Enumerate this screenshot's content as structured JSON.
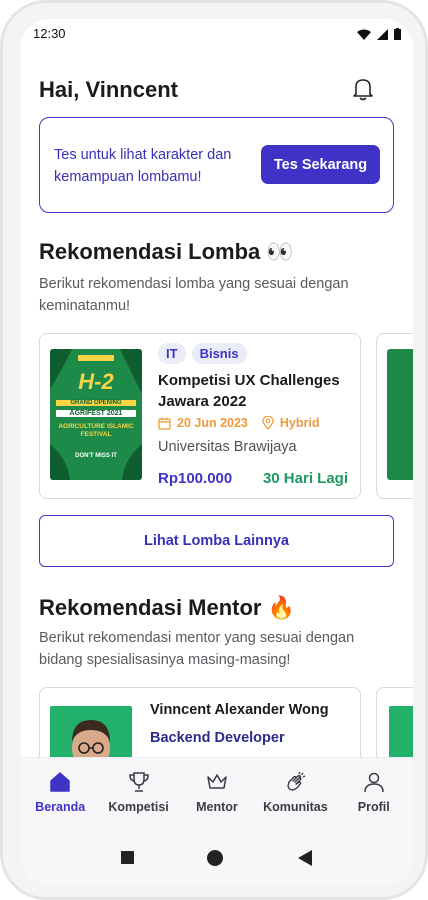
{
  "status_bar": {
    "time": "12:30"
  },
  "header": {
    "greeting": "Hai, Vinncent"
  },
  "banner": {
    "text": "Tes untuk lihat karakter dan kemampuan lombamu!",
    "button_label": "Tes Sekarang"
  },
  "lomba_section": {
    "title": "Rekomendasi Lomba 👀",
    "description": "Berikut rekomendasi lomba yang sesuai dengan keminatanmu!",
    "cards": [
      {
        "tags": [
          "IT",
          "Bisnis"
        ],
        "title": "Kompetisi UX Challenges Jawara 2022",
        "date": "20 Jun 2023",
        "mode": "Hybrid",
        "organizer": "Universitas Brawijaya",
        "price": "Rp100.000",
        "remaining": "30 Hari Lagi",
        "poster": {
          "headline": "H-2",
          "line1": "GRAND OPENING",
          "line2": "AGRIFEST 2021",
          "line3": "AGRICULTURE ISLAMIC FESTIVAL",
          "line4": "DON'T MISS IT"
        }
      }
    ],
    "more_button": "Lihat Lomba Lainnya"
  },
  "mentor_section": {
    "title": "Rekomendasi Mentor 🔥",
    "description": "Berikut rekomendasi mentor yang sesuai dengan bidang spesialisasinya masing-masing!",
    "cards": [
      {
        "name": "Vinncent Alexander Wong",
        "role": "Backend Developer"
      }
    ]
  },
  "bottom_nav": [
    {
      "label": "Beranda",
      "icon": "home-icon",
      "active": true
    },
    {
      "label": "Kompetisi",
      "icon": "trophy-icon",
      "active": false
    },
    {
      "label": "Mentor",
      "icon": "crown-icon",
      "active": false
    },
    {
      "label": "Komunitas",
      "icon": "clap-icon",
      "active": false
    },
    {
      "label": "Profil",
      "icon": "user-icon",
      "active": false
    }
  ],
  "colors": {
    "primary": "#3f33c7",
    "success": "#1f9a63",
    "warning": "#f29a3a",
    "poster_green": "#1e8a4a"
  }
}
